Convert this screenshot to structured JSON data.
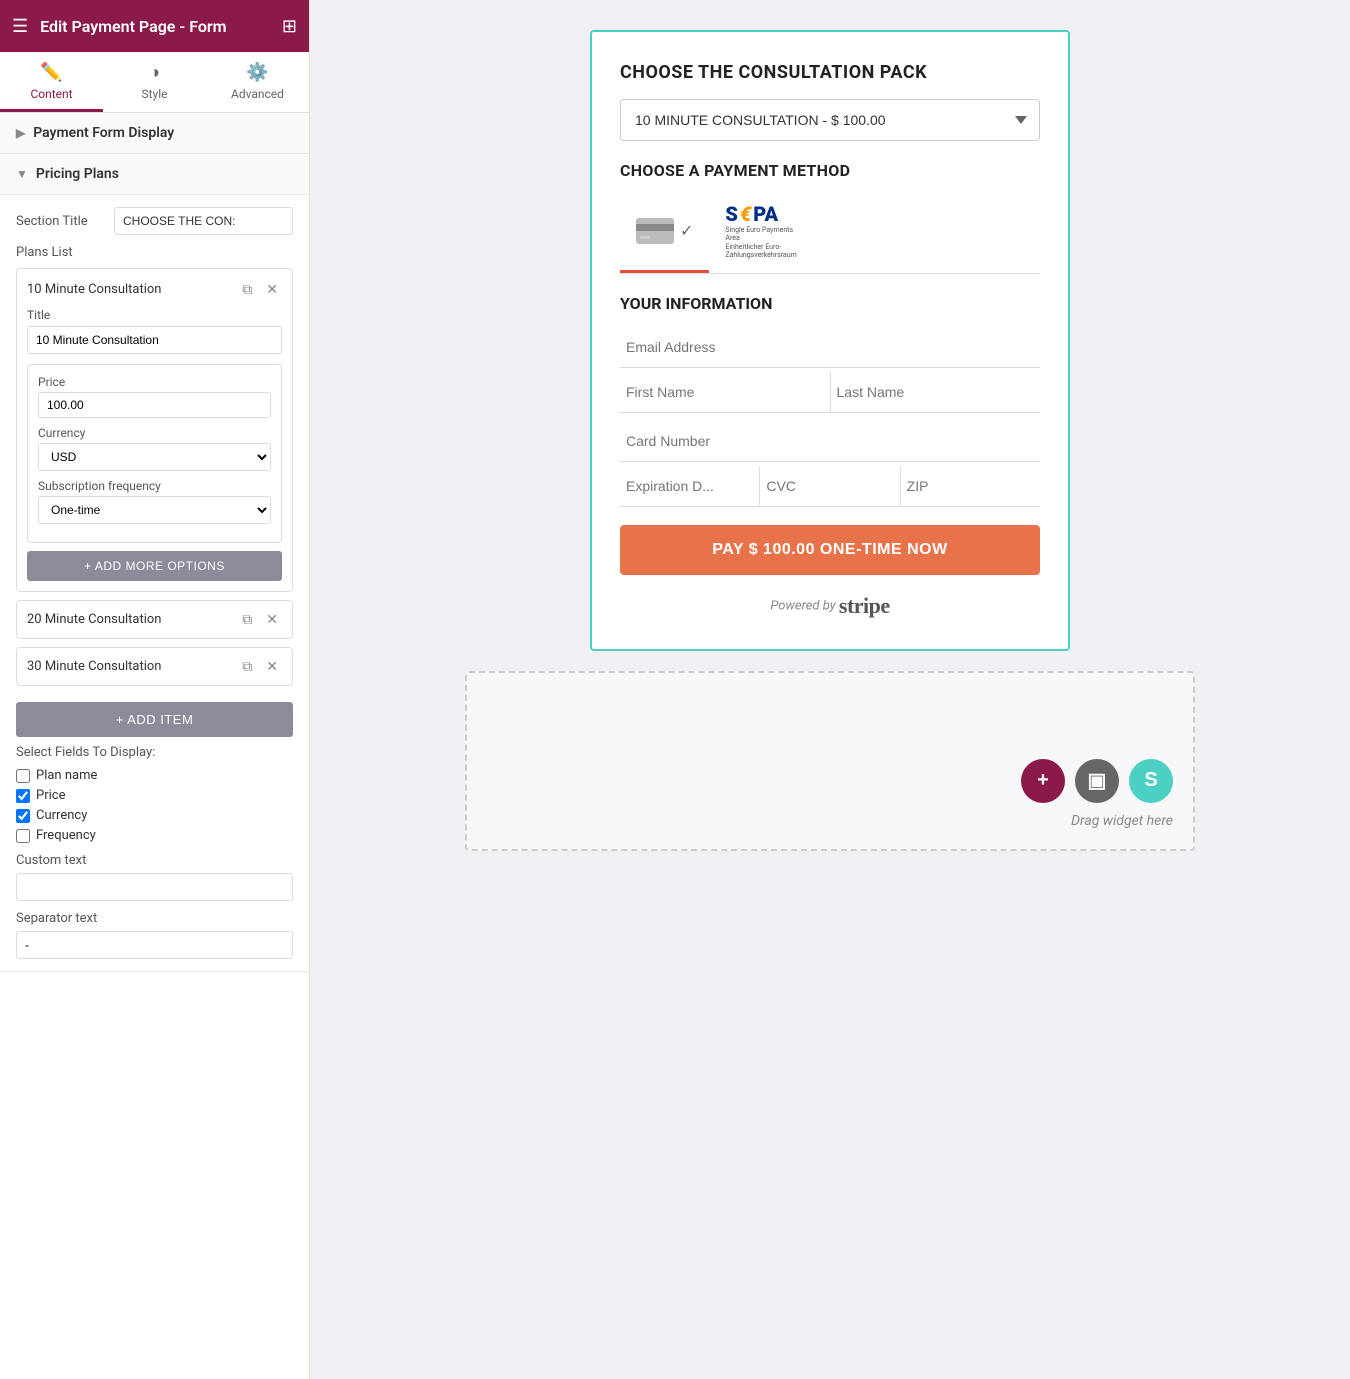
{
  "header": {
    "title": "Edit Payment Page - Form",
    "hamburger": "☰",
    "grid": "⊞"
  },
  "tabs": [
    {
      "id": "content",
      "label": "Content",
      "icon": "✏️",
      "active": true
    },
    {
      "id": "style",
      "label": "Style",
      "icon": "◑",
      "active": false
    },
    {
      "id": "advanced",
      "label": "Advanced",
      "icon": "⚙️",
      "active": false
    }
  ],
  "sections": {
    "payment_form_display": {
      "label": "Payment Form Display",
      "collapsed": true
    },
    "pricing_plans": {
      "label": "Pricing Plans",
      "collapsed": false
    }
  },
  "pricing_plans": {
    "section_title_label": "Section Title",
    "section_title_value": "CHOOSE THE CON:",
    "plans_list_label": "Plans List",
    "plans": [
      {
        "id": 1,
        "name": "10 Minute Consultation",
        "expanded": true,
        "title_label": "Title",
        "title_value": "10 Minute Consultation",
        "price_label": "Price",
        "price_value": "100.00",
        "currency_label": "Currency",
        "currency_value": "USD",
        "frequency_label": "Subscription frequency",
        "frequency_value": "One-time"
      },
      {
        "id": 2,
        "name": "20 Minute Consultation",
        "expanded": false
      },
      {
        "id": 3,
        "name": "30 Minute Consultation",
        "expanded": false
      }
    ],
    "add_more_options_label": "+ ADD MORE OPTIONS",
    "add_item_label": "+ ADD ITEM",
    "select_fields_label": "Select Fields To Display:",
    "fields": [
      {
        "id": "plan_name",
        "label": "Plan name",
        "checked": false
      },
      {
        "id": "price",
        "label": "Price",
        "checked": true
      },
      {
        "id": "currency",
        "label": "Currency",
        "checked": true
      },
      {
        "id": "frequency",
        "label": "Frequency",
        "checked": false
      }
    ],
    "custom_text_label": "Custom text",
    "custom_text_value": "",
    "separator_label": "Separator text",
    "separator_value": "-"
  },
  "payment_form": {
    "choose_pack_title": "CHOOSE THE CONSULTATION PACK",
    "selected_plan": "10 MINUTE CONSULTATION - $ 100.00",
    "payment_method_title": "CHOOSE A PAYMENT METHOD",
    "payment_methods": [
      {
        "id": "card",
        "active": true
      },
      {
        "id": "sepa",
        "active": false
      }
    ],
    "your_info_title": "YOUR INFORMATION",
    "email_placeholder": "Email Address",
    "first_name_placeholder": "First Name",
    "last_name_placeholder": "Last Name",
    "card_number_placeholder": "Card Number",
    "expiry_placeholder": "Expiration D...",
    "cvc_placeholder": "CVC",
    "zip_placeholder": "ZIP",
    "pay_button_label": "PAY $ 100.00 ONE-TIME NOW",
    "powered_by_text": "Powered by",
    "stripe_text": "stripe"
  },
  "drop_area": {
    "drag_text": "Drag widget here",
    "buttons": [
      {
        "id": "add",
        "symbol": "+",
        "type": "add"
      },
      {
        "id": "square",
        "symbol": "▣",
        "type": "gray"
      },
      {
        "id": "s",
        "symbol": "S",
        "type": "teal"
      }
    ]
  }
}
